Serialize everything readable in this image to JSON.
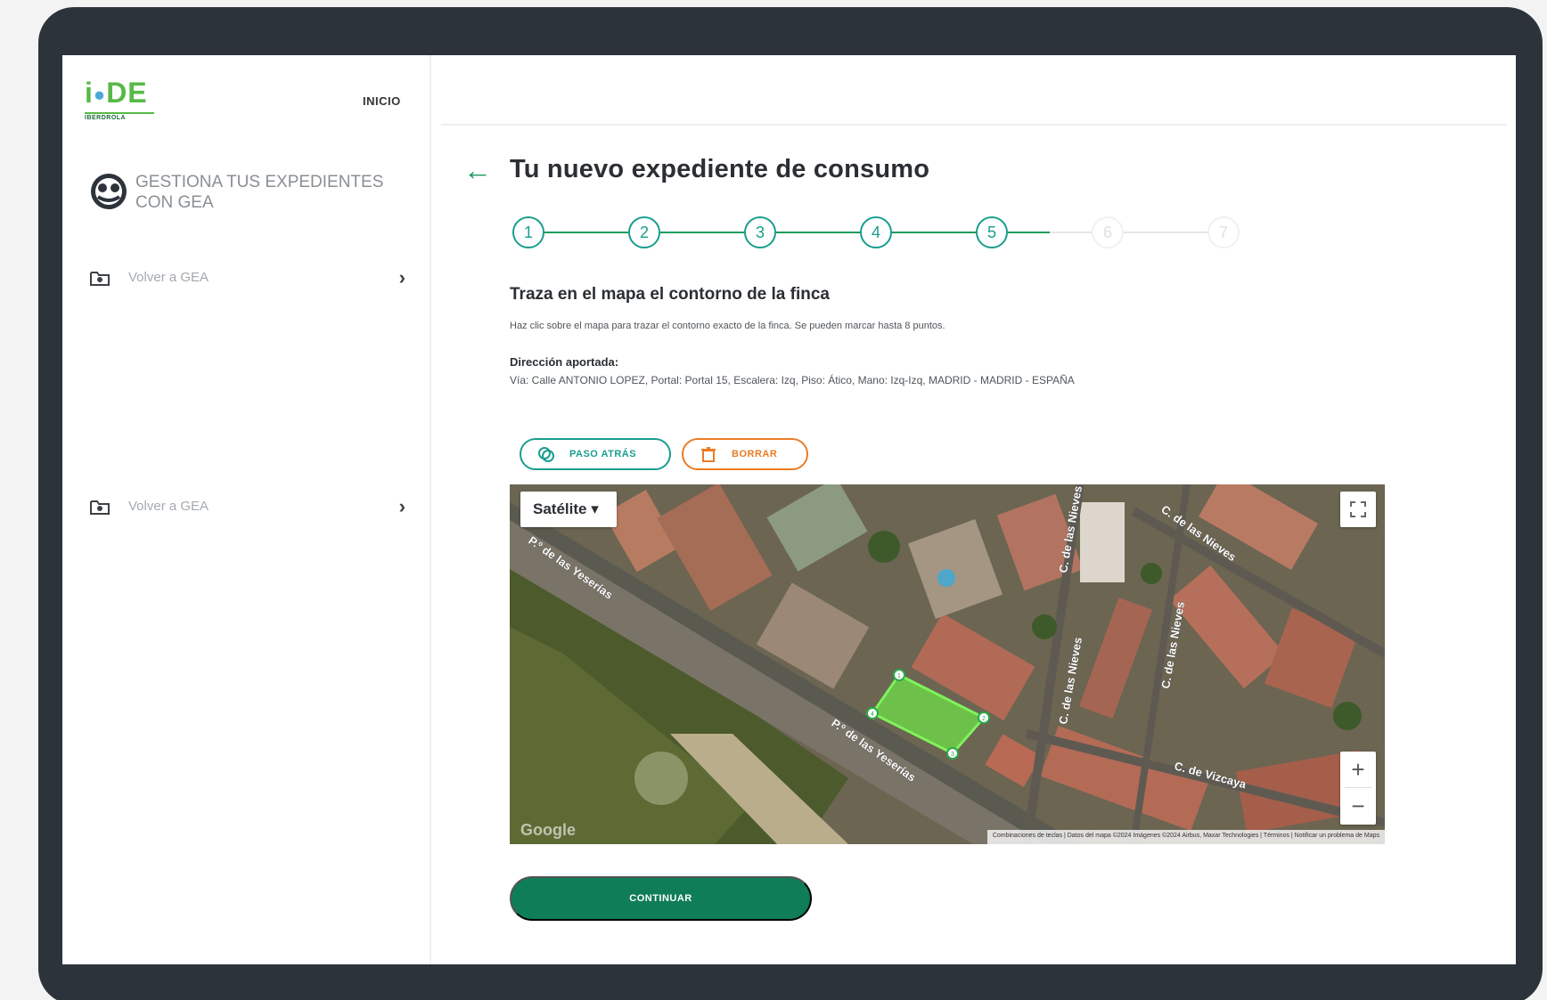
{
  "logo": {
    "brand": "i-DE",
    "sub": "IBERDROLA"
  },
  "header": {
    "inicio_label": "INICIO"
  },
  "sidebar": {
    "gestiona_label": "GESTIONA TUS EXPEDIENTES CON GEA",
    "items": [
      {
        "label": "Volver a GEA",
        "icon": "folder-icon"
      },
      {
        "label": "Volver a GEA",
        "icon": "folder-icon"
      }
    ]
  },
  "main": {
    "title": "Tu nuevo expediente de consumo",
    "steps": [
      {
        "label": "1",
        "state": "done"
      },
      {
        "label": "2",
        "state": "done"
      },
      {
        "label": "3",
        "state": "done"
      },
      {
        "label": "4",
        "state": "done"
      },
      {
        "label": "5",
        "state": "current"
      },
      {
        "label": "6",
        "state": "pending"
      },
      {
        "label": "7",
        "state": "pending"
      }
    ],
    "section_title": "Traza en el mapa el contorno de la finca",
    "instructions": "Haz clic sobre el mapa para trazar el contorno exacto de la finca. Se pueden marcar hasta 8 puntos.",
    "address_label": "Dirección aportada:",
    "address_value": "Vía: Calle ANTONIO LOPEZ, Portal: Portal 15, Escalera: Izq, Piso: Ático, Mano: Izq-Izq, MADRID - MADRID - ESPAÑA",
    "back_button": "PASO ATRÁS",
    "delete_button": "BORRAR",
    "continue_button": "CONTINUAR"
  },
  "map": {
    "type_label": "Satélite",
    "google_label": "Google",
    "attribution": "Combinaciones de teclas | Datos del mapa ©2024 Imágenes ©2024 Airbus, Maxar Technologies | Términos | Notificar un problema de Maps",
    "streets": [
      "P.º de las Yeserías",
      "P.º de las Yeserías",
      "C. de las Nieves",
      "C. de las Nieves",
      "C. de las Nieves",
      "C. de las Nieves",
      "C. de Vizcaya"
    ],
    "polygon_points": [
      "1",
      "2",
      "3",
      "4"
    ]
  },
  "colors": {
    "brand_green": "#57b947",
    "step_teal": "#1a9d8f",
    "cta_green": "#0f7d57",
    "delete_orange": "#ea7b24"
  }
}
